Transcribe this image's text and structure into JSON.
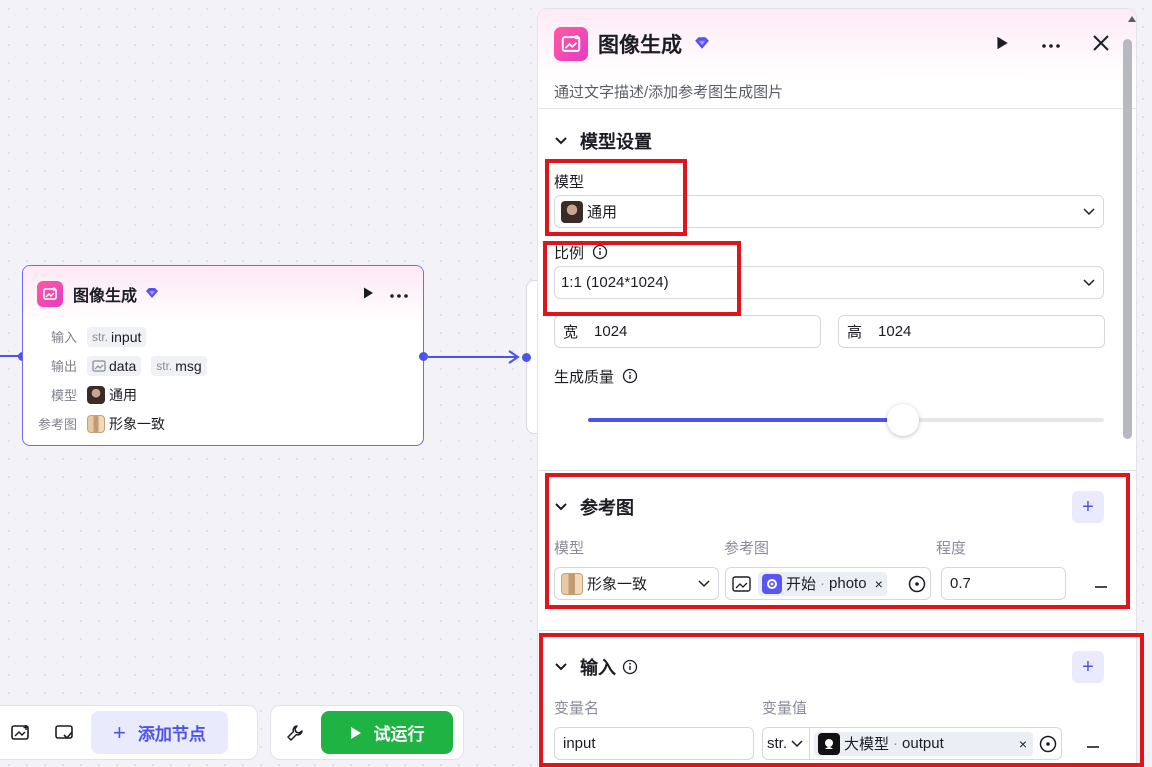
{
  "node": {
    "title": "图像生成",
    "rows": {
      "input_label": "输入",
      "input_type": "str.",
      "input_name": "input",
      "output_label": "输出",
      "output_data": "data",
      "output_type": "str.",
      "output_msg": "msg",
      "model_label": "模型",
      "model_value": "通用",
      "ref_label": "参考图",
      "ref_value": "形象一致"
    }
  },
  "toolbar": {
    "add_node": "添加节点",
    "run": "试运行"
  },
  "panel": {
    "title": "图像生成",
    "description": "通过文字描述/添加参考图生成图片",
    "model_settings": {
      "title": "模型设置",
      "model_label": "模型",
      "model_value": "通用",
      "ratio_label": "比例",
      "ratio_value": "1:1 (1024*1024)",
      "width_label": "宽",
      "width_value": "1024",
      "height_label": "高",
      "height_value": "1024",
      "quality_label": "生成质量",
      "quality_fraction": 0.61
    },
    "reference": {
      "title": "参考图",
      "col_model": "模型",
      "col_image": "参考图",
      "col_degree": "程度",
      "row": {
        "model": "形象一致",
        "source": "开始",
        "separator": "·",
        "var": "photo",
        "degree": "0.7"
      }
    },
    "inputs": {
      "title": "输入",
      "col_name": "变量名",
      "col_value": "变量值",
      "row": {
        "name": "input",
        "type": "str.",
        "source": "大模型",
        "separator": "·",
        "var": "output"
      }
    }
  },
  "colors": {
    "accent": "#4d53e8",
    "run_green": "#1fb344",
    "highlight_red": "#e0141b"
  }
}
